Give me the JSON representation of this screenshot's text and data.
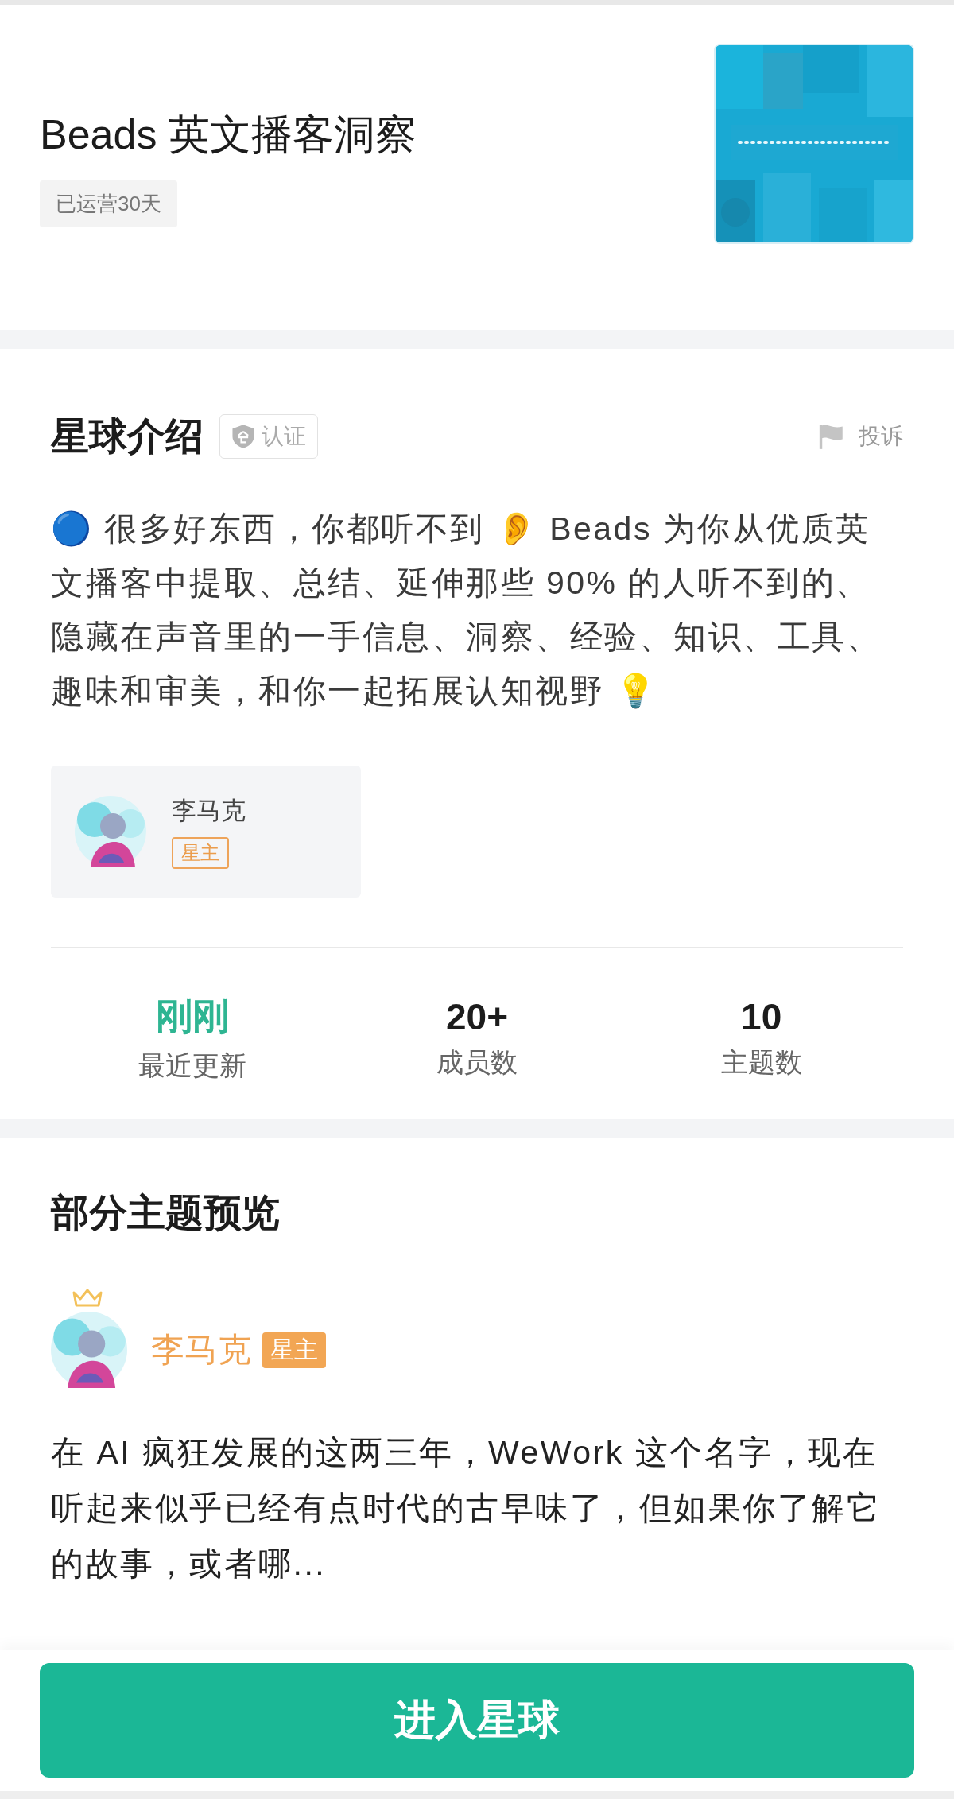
{
  "header": {
    "title": "Beads 英文播客洞察",
    "age_badge": "已运营30天"
  },
  "intro": {
    "heading": "星球介绍",
    "verified_label": "认证",
    "report_label": "投诉",
    "description": "🔵 很多好东西，你都听不到 👂 Beads 为你从优质英文播客中提取、总结、延伸那些 90% 的人听不到的、隐藏在声音里的一手信息、洞察、经验、知识、工具、趣味和审美，和你一起拓展认知视野 💡",
    "owner": {
      "name": "李马克",
      "role": "星主"
    }
  },
  "stats": [
    {
      "value": "刚刚",
      "label": "最近更新",
      "highlight": true
    },
    {
      "value": "20+",
      "label": "成员数",
      "highlight": false
    },
    {
      "value": "10",
      "label": "主题数",
      "highlight": false
    }
  ],
  "preview": {
    "heading": "部分主题预览",
    "posts": [
      {
        "author": "李马克",
        "role": "星主",
        "excerpt": "在 AI 疯狂发展的这两三年，WeWork 这个名字，现在听起来似乎已经有点时代的古早味了，但如果你了解它的故事，或者哪..."
      }
    ]
  },
  "enter_button": "进入星球"
}
